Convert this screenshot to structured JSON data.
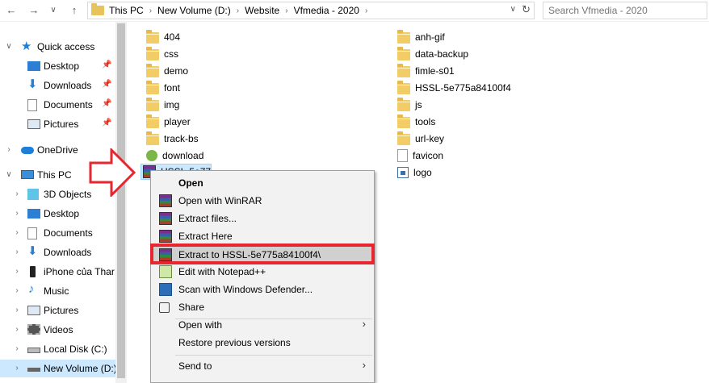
{
  "address_bar": {
    "crumbs": [
      "This PC",
      "New Volume (D:)",
      "Website",
      "Vfmedia - 2020"
    ],
    "search_placeholder": "Search Vfmedia - 2020"
  },
  "nav": {
    "quick_access": "Quick access",
    "qa_items": [
      "Desktop",
      "Downloads",
      "Documents",
      "Pictures"
    ],
    "onedrive": "OneDrive",
    "this_pc": "This PC",
    "pc_items": [
      "3D Objects",
      "Desktop",
      "Documents",
      "Downloads",
      "iPhone của Thar",
      "Music",
      "Pictures",
      "Videos",
      "Local Disk (C:)",
      "New Volume (D:)"
    ]
  },
  "files": {
    "col1": [
      {
        "name": "404",
        "type": "folder"
      },
      {
        "name": "css",
        "type": "folder"
      },
      {
        "name": "demo",
        "type": "folder"
      },
      {
        "name": "font",
        "type": "folder"
      },
      {
        "name": "img",
        "type": "folder"
      },
      {
        "name": "player",
        "type": "folder"
      },
      {
        "name": "track-bs",
        "type": "folder"
      },
      {
        "name": "download",
        "type": "download"
      },
      {
        "name": "HSSL-5e775a84100f4",
        "type": "rar"
      }
    ],
    "col2": [
      {
        "name": "anh-gif",
        "type": "folder"
      },
      {
        "name": "data-backup",
        "type": "folder"
      },
      {
        "name": "fimle-s01",
        "type": "folder"
      },
      {
        "name": "HSSL-5e775a84100f4",
        "type": "folder"
      },
      {
        "name": "js",
        "type": "folder"
      },
      {
        "name": "tools",
        "type": "folder"
      },
      {
        "name": "url-key",
        "type": "folder"
      },
      {
        "name": "favicon",
        "type": "doc"
      },
      {
        "name": "logo",
        "type": "image"
      }
    ]
  },
  "context_menu": {
    "items": [
      {
        "label": "Open",
        "bold": true
      },
      {
        "label": "Open with WinRAR",
        "icon": "winrar-icon"
      },
      {
        "label": "Extract files...",
        "icon": "winrar-icon"
      },
      {
        "label": "Extract Here",
        "icon": "winrar-icon"
      },
      {
        "label": "Extract to HSSL-5e775a84100f4\\",
        "icon": "winrar-icon",
        "highlighted": true
      },
      {
        "label": "Edit with Notepad++",
        "icon": "notepadpp-icon"
      },
      {
        "label": "Scan with Windows Defender...",
        "icon": "defender-icon"
      },
      {
        "label": "Share",
        "icon": "share-icon"
      },
      {
        "label": "Open with",
        "submenu": true
      },
      {
        "label": "Restore previous versions"
      },
      {
        "label": "Send to",
        "submenu": true
      }
    ]
  },
  "colors": {
    "annotation_red": "#e8262f",
    "selection_blue": "#cce8ff"
  }
}
